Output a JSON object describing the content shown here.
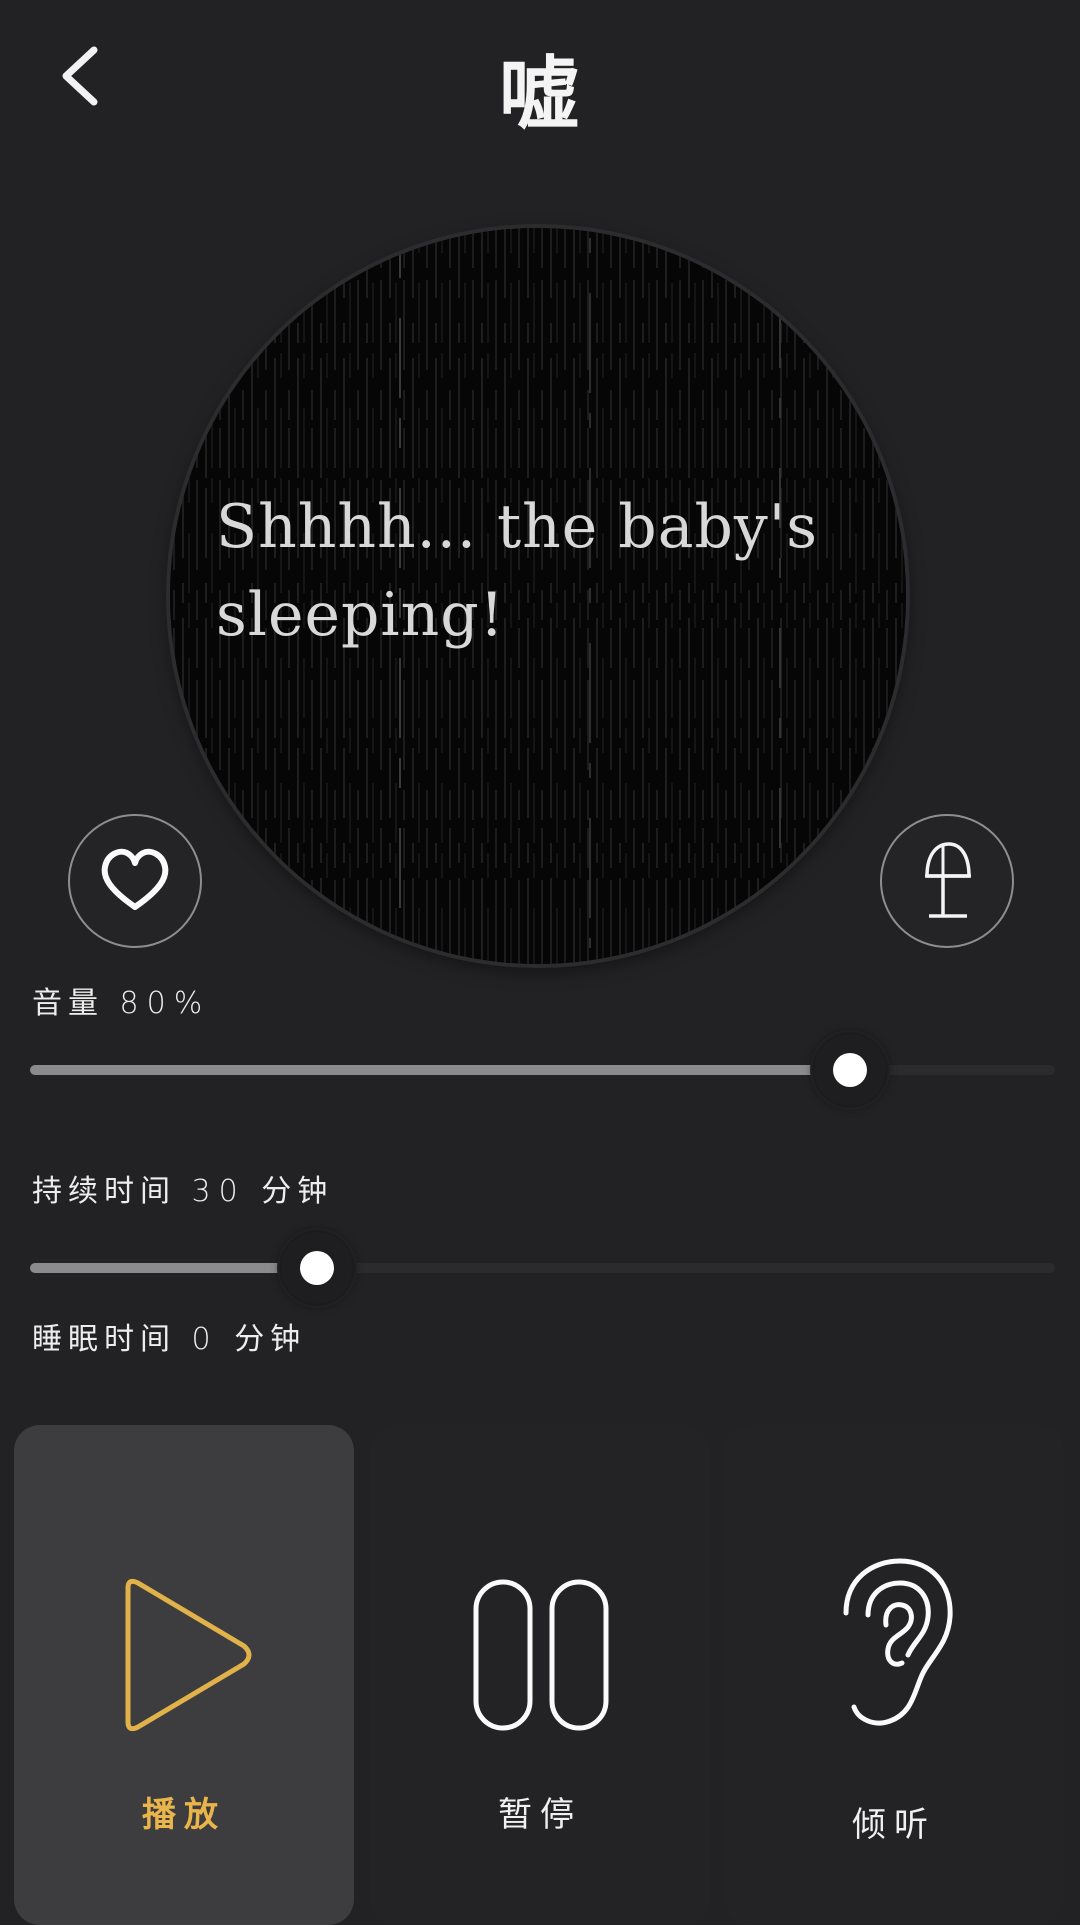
{
  "header": {
    "title": "嘘",
    "back_icon": "chevron-left-icon"
  },
  "cover": {
    "caption_line1": "Shhhh... the baby's",
    "caption_line2": "sleeping!"
  },
  "actions": {
    "favorite_icon": "heart-icon",
    "lamp_icon": "lamp-icon"
  },
  "volume": {
    "label": "音量",
    "value_text": "80%",
    "level": 0.8
  },
  "duration": {
    "label": "持续时间",
    "value_text": "30",
    "unit": "分钟",
    "level": 0.28
  },
  "sleep_time": {
    "label": "睡眠时间",
    "value_text": "0",
    "unit": "分钟"
  },
  "controls": [
    {
      "label": "播放",
      "icon": "play-icon",
      "active": true
    },
    {
      "label": "暂停",
      "icon": "pause-icon",
      "active": false
    },
    {
      "label": "倾听",
      "icon": "ear-icon",
      "active": false
    }
  ],
  "colors": {
    "background": "#222123",
    "accent": "#e9b54a",
    "active_panel": "#3d3d3f"
  }
}
